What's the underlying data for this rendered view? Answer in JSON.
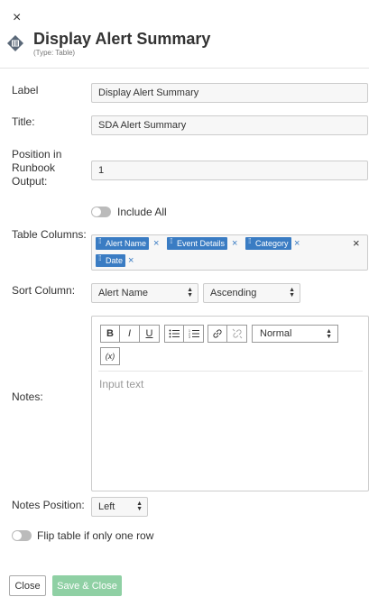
{
  "header": {
    "close_glyph": "×",
    "title": "Display Alert Summary",
    "subtitle": "(Type: Table)"
  },
  "form": {
    "label_label": "Label",
    "label_value": "Display Alert Summary",
    "title_label": "Title:",
    "title_value": "SDA Alert Summary",
    "position_label": "Position in Runbook Output:",
    "position_value": "1",
    "include_all_label": "Include All",
    "include_all_on": false,
    "table_columns_label": "Table Columns:",
    "table_columns": [
      "Alert Name",
      "Event Details",
      "Category",
      "Date"
    ],
    "sort_column_label": "Sort Column:",
    "sort_column_value": "Alert Name",
    "sort_order_value": "Ascending",
    "notes_label": "Notes:",
    "notes_placeholder": "Input text",
    "notes_format_value": "Normal",
    "notes_position_label": "Notes Position:",
    "notes_position_value": "Left",
    "flip_table_label": "Flip table if only one row",
    "flip_table_on": false
  },
  "toolbar": {
    "bold": "B",
    "italic": "I",
    "underline": "U",
    "formula": "(x)"
  },
  "footer": {
    "close_label": "Close",
    "save_close_label": "Save & Close"
  },
  "colors": {
    "tag": "#3a7cc3",
    "save_disabled": "#8fd0a4"
  }
}
